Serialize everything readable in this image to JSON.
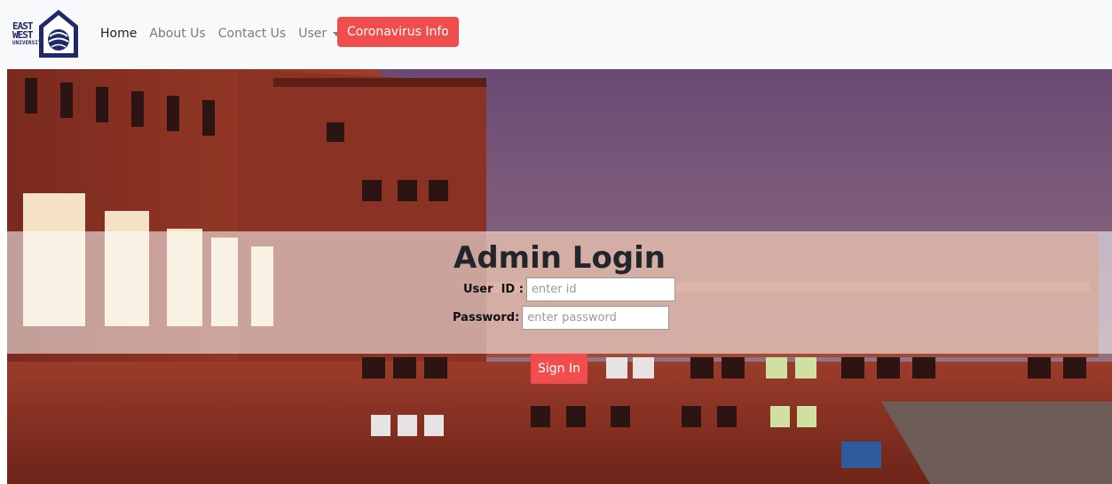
{
  "logo": {
    "line1": "EAST",
    "line2": "WEST",
    "line3": "UNIVERSITY"
  },
  "nav": {
    "home": "Home",
    "about": "About Us",
    "contact": "Contact Us",
    "user": "User",
    "cta": "Coronavirus Info"
  },
  "login": {
    "title": "Admin Login",
    "user_id_label": "User  ID :",
    "user_id_placeholder": "enter id",
    "password_label": "Password:",
    "password_placeholder": "enter password",
    "submit": "Sign In"
  },
  "colors": {
    "accent": "#f14d4d",
    "navbar_bg": "#f8f9fa",
    "sky": "#6d4f78",
    "brick": "#8b2f22"
  }
}
